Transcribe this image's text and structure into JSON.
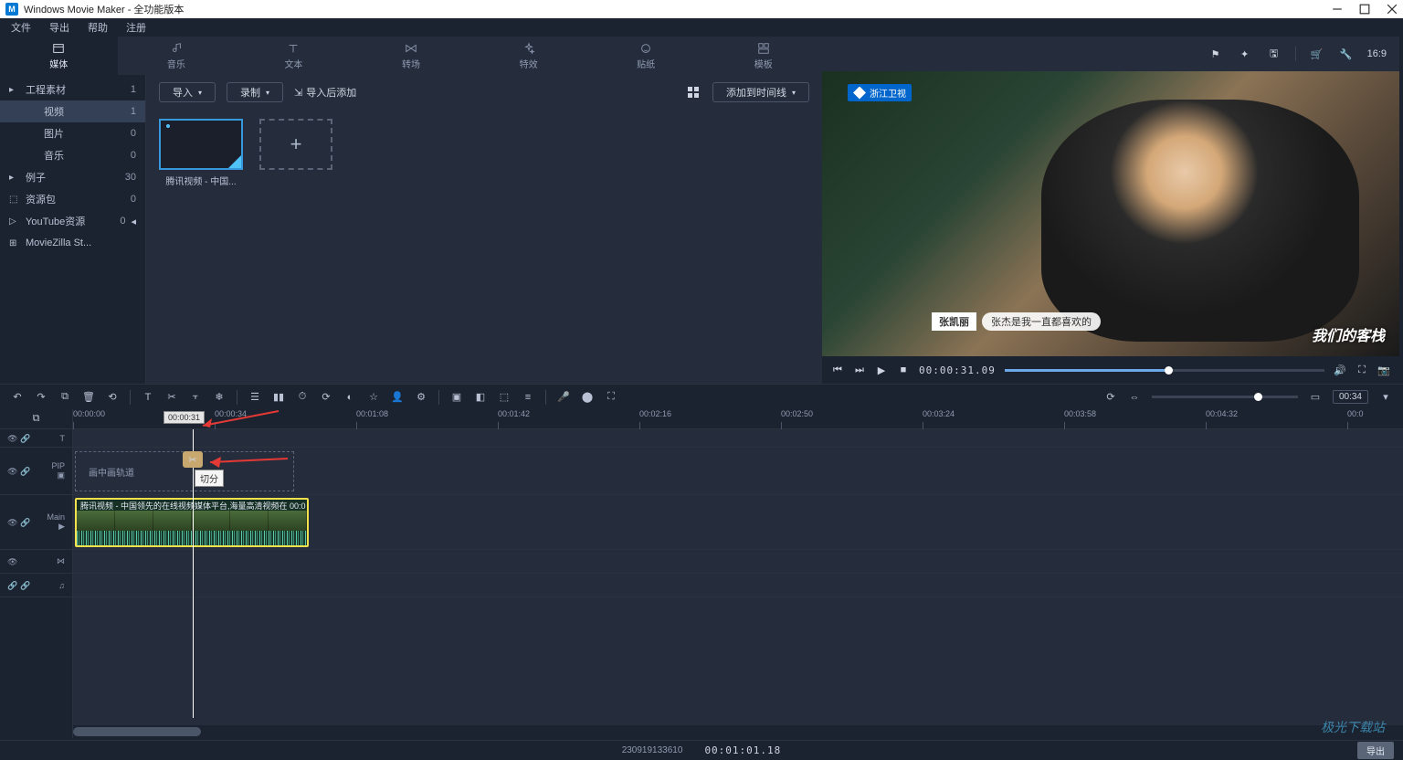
{
  "titlebar": {
    "app": "Windows Movie Maker",
    "suffix": " - 全功能版本"
  },
  "menu": [
    "文件",
    "导出",
    "帮助",
    "注册"
  ],
  "tabs": [
    {
      "label": "媒体"
    },
    {
      "label": "音乐"
    },
    {
      "label": "文本"
    },
    {
      "label": "转场"
    },
    {
      "label": "特效"
    },
    {
      "label": "贴纸"
    },
    {
      "label": "模板"
    }
  ],
  "sidebar": [
    {
      "icon": "▸",
      "label": "工程素材",
      "count": "1",
      "expandable": true
    },
    {
      "icon": "",
      "label": "视频",
      "count": "1",
      "indent": true,
      "active": true
    },
    {
      "icon": "",
      "label": "图片",
      "count": "0",
      "indent": true
    },
    {
      "icon": "",
      "label": "音乐",
      "count": "0",
      "indent": true
    },
    {
      "icon": "▸",
      "label": "例子",
      "count": "30",
      "expandable": true
    },
    {
      "icon": "⬚",
      "label": "资源包",
      "count": "0"
    },
    {
      "icon": "▷",
      "label": "YouTube资源",
      "count": "0",
      "arrow": true
    },
    {
      "icon": "⊞",
      "label": "MovieZilla St...",
      "count": ""
    }
  ],
  "media_bar": {
    "import": "导入",
    "record": "录制",
    "after_import": "导入后添加",
    "add_timeline": "添加到时间线"
  },
  "thumbs": [
    {
      "label": "腾讯视频 - 中国..."
    }
  ],
  "preview": {
    "tv_logo": "浙江卫视",
    "name_tag": "张凯丽",
    "subtitle": "张杰是我一直都喜欢的",
    "watermark": "我们的客栈",
    "ratio": "16:9",
    "timecode": "00:00:31.09"
  },
  "ruler": [
    "00:00:00",
    "00:00:34",
    "00:01:08",
    "00:01:42",
    "00:02:16",
    "00:02:50",
    "00:03:24",
    "00:03:58",
    "00:04:32",
    "00:0"
  ],
  "playhead_time": "00:00:31",
  "pip_label": "画中画轨道",
  "split_tooltip": "切分",
  "clip_title": "腾讯视频 - 中国领先的在线视频媒体平台,海量高清视频在  00:0",
  "zoom_time": "00:34",
  "status": {
    "id": "230919133610",
    "tc": "00:01:01.18",
    "export": "导出"
  },
  "tracks": {
    "pip": "PIP",
    "main": "Main"
  }
}
